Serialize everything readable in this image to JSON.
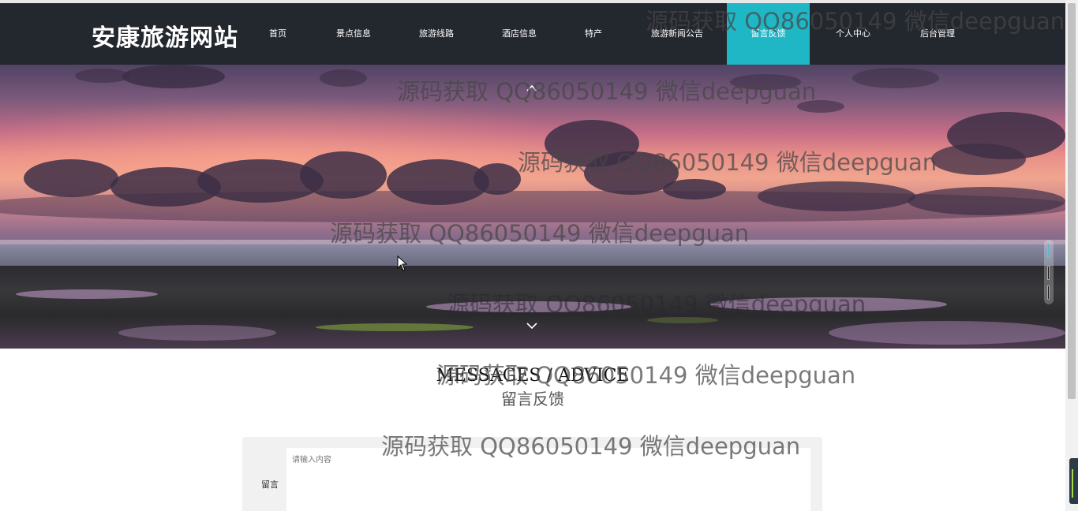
{
  "site": {
    "title": "安康旅游网站"
  },
  "nav": {
    "items": [
      {
        "label": "首页"
      },
      {
        "label": "景点信息"
      },
      {
        "label": "旅游线路"
      },
      {
        "label": "酒店信息"
      },
      {
        "label": "特产"
      },
      {
        "label": "旅游新闻公告"
      },
      {
        "label": "留言反馈",
        "active": true
      },
      {
        "label": "个人中心"
      },
      {
        "label": "后台管理"
      }
    ]
  },
  "banner": {
    "prev_icon": "chevron-up-icon",
    "next_icon": "chevron-down-icon",
    "slides": 3,
    "active_slide": 1
  },
  "section": {
    "title_en": "MESSAGES / ADVICE",
    "title_cn": "留言反馈"
  },
  "form": {
    "label": "留言",
    "placeholder": "请输入内容"
  },
  "watermark": {
    "text": "源码获取 QQ86050149 微信deepguan"
  },
  "colors": {
    "header_bg": "#23272e",
    "active_nav": "#1fb6c6"
  }
}
